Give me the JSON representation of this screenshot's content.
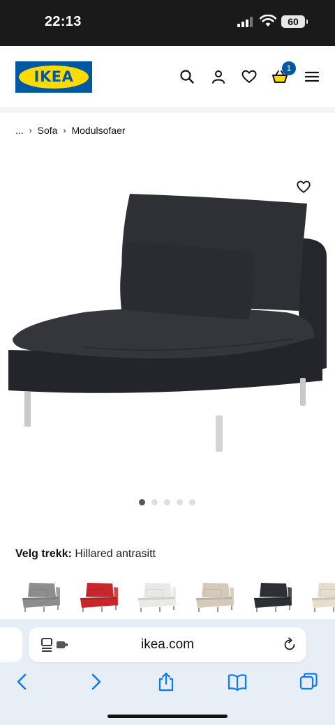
{
  "status_bar": {
    "time": "22:13",
    "battery": "60"
  },
  "header": {
    "logo_text": "IKEA",
    "cart_count": "1",
    "icons": [
      "search-icon",
      "account-icon",
      "heart-icon",
      "basket-icon",
      "menu-icon"
    ]
  },
  "breadcrumb": {
    "ellipsis": "...",
    "items": [
      "Sofa",
      "Modulsofaer"
    ]
  },
  "gallery": {
    "image_count": 5,
    "active_index": 0
  },
  "product": {
    "cover_label": "Velg trekk:",
    "cover_value": "Hillared antrasitt"
  },
  "swatches": [
    {
      "color": "#8d8d8d"
    },
    {
      "color": "#c8262b"
    },
    {
      "color": "#e9e9e7"
    },
    {
      "color": "#d5c9b8"
    },
    {
      "color": "#2e2f34"
    },
    {
      "color": "#e6ddcc"
    }
  ],
  "browser": {
    "url": "ikea.com",
    "accent": "#0a7aff"
  },
  "brand": {
    "blue": "#0058a3",
    "yellow": "#ffdb00"
  }
}
